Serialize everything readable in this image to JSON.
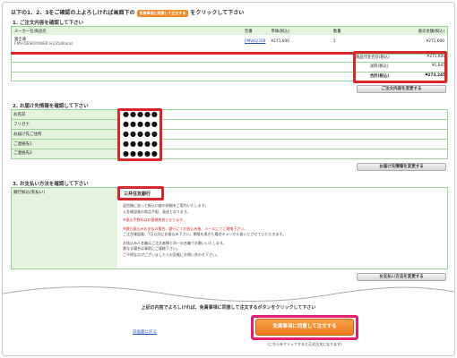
{
  "intro": {
    "prefix": "以下の1、2、3をご確認の上よろしければ画面下の",
    "button_text": "免責事項に同意して注文する",
    "suffix": "をクリックして下さい"
  },
  "section1": {
    "title": "1. ご注文内容を確認して下さい",
    "headers": [
      "メーカー名/商品名",
      "型番",
      "単価(税込)",
      "数量",
      "販売金額(税込)"
    ],
    "item": {
      "maker": "富士通",
      "name": "FMV-DESKPOWER H235(Black)",
      "model": "FMVH235B",
      "price": "¥271,600",
      "qty": "1",
      "total": "¥271,600"
    },
    "summary": [
      {
        "label": "商品代金合計(税込)",
        "value": "¥271,600"
      },
      {
        "label": "送料(税込)",
        "value": "¥1,645"
      },
      {
        "label": "合計(税込)",
        "value": "¥273,245"
      }
    ],
    "change_button": "ご注文内容を変更する"
  },
  "section2": {
    "title": "2. お届け先情報を確認して下さい",
    "rows": [
      {
        "label": "お名前",
        "value": "●●●●●"
      },
      {
        "label": "フリガナ",
        "value": "●●●●●"
      },
      {
        "label": "お届け先ご住所",
        "value": "●●●●●"
      },
      {
        "label": "ご連絡先1",
        "value": "●●●●●"
      },
      {
        "label": "ご連絡先2",
        "value": "●●●●●"
      }
    ],
    "change_button": "お届け先情報を変更する"
  },
  "section3": {
    "title": "3. お支払い方法を確認して下さい",
    "label": "銀行振込(先払い)",
    "bank": "三井住友銀行",
    "notes": [
      "返信後に追って振込口座の詳細をご案内いたします。",
      "入金確認後の商品手配、発送となります。",
      "※振込手数料はお客様負担となります。",
      "※銀行振込みお支払の場合、銀行にてお振込み後、メールにてご連絡下さい。",
      "ご注文確認後、7日以内にお振込み下さい。期限を過ぎた場合キャンセル扱いとさせていただきます。",
      "お振込み人名義はご注文者様と同一の名義でお願いいたします。",
      "異なる場合は事前にご連絡下さい。",
      "ご不明な点がございましたらお気軽にお問い合わせ下さい。"
    ],
    "change_button": "お支払い方法を変更する"
  },
  "footer": {
    "instruction": "上記の内容でよろしければ、免責事項に同意して注文するボタンをクリックして下さい",
    "back_link": "前画面に戻る",
    "submit_button": "免責事項に同意して注文する",
    "submit_note": "(こちらをクリックすると正式注文になります)"
  },
  "colors": {
    "highlight_red": "#d7262c",
    "submit_orange": "#f08a2a",
    "section_green": "#9bd29b",
    "pink_border": "#e0206e"
  }
}
